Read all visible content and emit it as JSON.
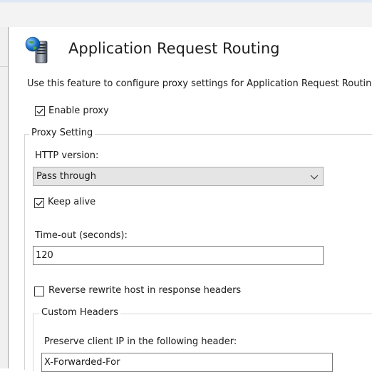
{
  "header": {
    "title": "Application Request Routing",
    "icon": "server-globe-icon",
    "description": "Use this feature to configure proxy settings for Application Request Routing."
  },
  "enable_proxy": {
    "label": "Enable proxy",
    "checked": true
  },
  "proxy_setting": {
    "title": "Proxy Setting",
    "http_version": {
      "label": "HTTP version:",
      "value": "Pass through"
    },
    "keep_alive": {
      "label": "Keep alive",
      "checked": true
    },
    "timeout": {
      "label": "Time-out (seconds):",
      "value": "120"
    },
    "reverse_rewrite": {
      "label": "Reverse rewrite host in response headers",
      "checked": false
    },
    "custom_headers": {
      "title": "Custom Headers",
      "preserve_ip": {
        "label": "Preserve client IP in the following header:",
        "value": "X-Forwarded-For"
      }
    }
  },
  "colors": {
    "window_band": "#f3f3f3",
    "left_pane": "#f0f0f0",
    "select_bg": "#e5e5e5",
    "group_border": "#d5d5d5"
  }
}
